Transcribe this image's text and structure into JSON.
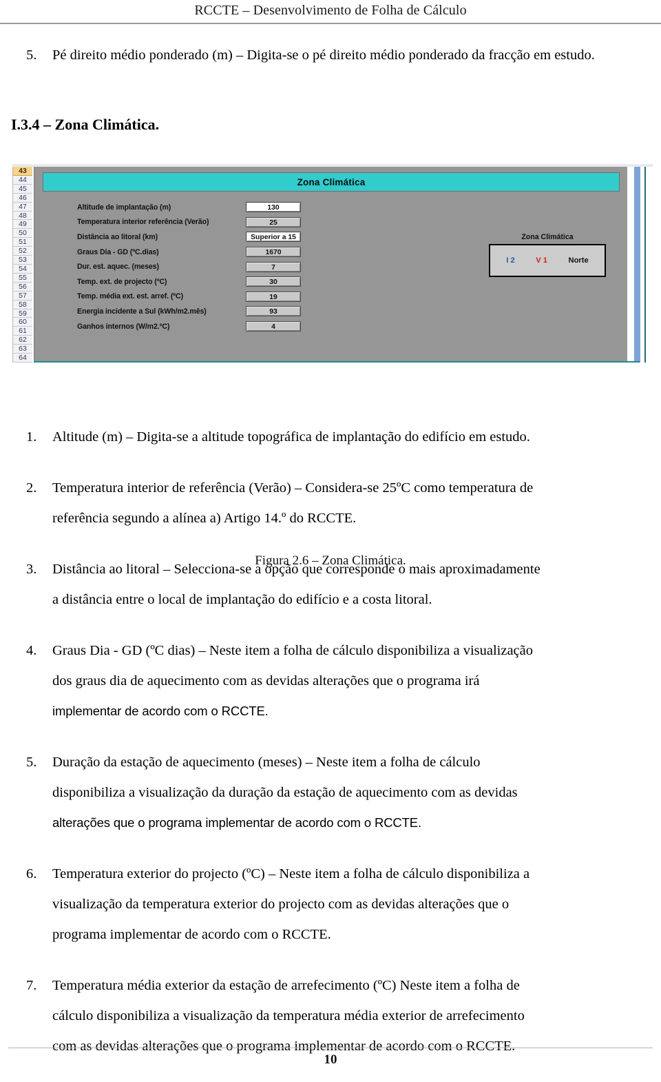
{
  "document": {
    "running_header": "RCCTE – Desenvolvimento de Folha de Cálculo",
    "page_number": "10"
  },
  "top_list": {
    "item5_marker": "5.",
    "item5_text": "Pé direito médio ponderado (m) – Digita-se o pé direito médio ponderado da fracção em estudo."
  },
  "section": {
    "heading": "I.3.4 – Zona Climática."
  },
  "figure": {
    "caption": "Figura 2.6 – Zona Climática.",
    "banner_title": "Zona Climática",
    "row_headers": [
      "43",
      "44",
      "45",
      "46",
      "47",
      "48",
      "49",
      "50",
      "51",
      "52",
      "53",
      "54",
      "55",
      "56",
      "57",
      "58",
      "59",
      "60",
      "61",
      "62",
      "63",
      "64"
    ],
    "selected_row": "43",
    "fields": [
      {
        "label": "Altitude de implantação (m)",
        "value": "130",
        "kind": "input"
      },
      {
        "label": "Temperatura interior referência (Verão)",
        "value": "25",
        "kind": "computed"
      },
      {
        "label": "Distância ao litoral (km)",
        "value": "Superior a 15",
        "kind": "input"
      },
      {
        "label": "Graus Dia - GD (ºC.dias)",
        "value": "1670",
        "kind": "computed"
      },
      {
        "label": "Dur. est. aquec. (meses)",
        "value": "7",
        "kind": "computed"
      },
      {
        "label": "Temp. ext. de projecto (ºC)",
        "value": "30",
        "kind": "computed"
      },
      {
        "label": "Temp. média ext. est. arref. (ºC)",
        "value": "19",
        "kind": "computed"
      },
      {
        "label": "Energia incidente a Sul (kWh/m2.mês)",
        "value": "93",
        "kind": "computed"
      },
      {
        "label": "Ganhos internos (W/m2.ºC)",
        "value": "4",
        "kind": "computed"
      }
    ],
    "result": {
      "caption": "Zona Climática",
      "winter": "I 2",
      "summer": "V 1",
      "region": "Norte"
    },
    "colors": {
      "banner": "#33CCCC",
      "sheet_background": "#969696",
      "result_box": "#CCCCCC",
      "winter_text": "#3355AA",
      "summer_text": "#CC2222",
      "selected_row_header": "#FBD38A",
      "scrollbar": "#7FA3D6"
    }
  },
  "body_list": [
    {
      "marker": "1.",
      "lines": [
        {
          "text": "Altitude (m) – Digita-se a altitude topográfica de implantação do edifício em estudo.",
          "face": "serif"
        }
      ]
    },
    {
      "marker": "2.",
      "lines": [
        {
          "text": "Temperatura interior de referência (Verão) – Considera-se 25ºC como temperatura de",
          "face": "serif"
        },
        {
          "text": "referência segundo a alínea a) Artigo 14.º do RCCTE.",
          "face": "serif"
        }
      ]
    },
    {
      "marker": "3.",
      "lines": [
        {
          "text": "Distância ao litoral – Selecciona-se a opção que corresponde o mais aproximadamente",
          "face": "serif"
        },
        {
          "text": "a distância entre o local de implantação do edifício e a costa litoral.",
          "face": "serif"
        }
      ]
    },
    {
      "marker": "4.",
      "lines": [
        {
          "text": "Graus Dia - GD (ºC dias) – Neste item a folha de cálculo disponibiliza a visualização",
          "face": "serif"
        },
        {
          "text": "dos graus dia de aquecimento com as devidas alterações que o programa irá",
          "face": "serif"
        },
        {
          "text": "implementar de acordo com o RCCTE.",
          "face": "sans"
        }
      ]
    },
    {
      "marker": "5.",
      "lines": [
        {
          "text": "Duração da estação de aquecimento (meses) – Neste item a folha de cálculo",
          "face": "serif"
        },
        {
          "text": "disponibiliza a visualização da duração da estação de aquecimento com as devidas",
          "face": "serif"
        },
        {
          "text": "alterações que o programa implementar de acordo com o RCCTE.",
          "face": "sans"
        }
      ]
    },
    {
      "marker": "6.",
      "lines": [
        {
          "text": "Temperatura exterior do projecto (ºC) – Neste item a folha de cálculo disponibiliza a",
          "face": "serif"
        },
        {
          "text": "visualização da temperatura exterior do projecto com as devidas alterações que o",
          "face": "serif"
        },
        {
          "text": "programa implementar de acordo com o RCCTE.",
          "face": "serif"
        }
      ]
    },
    {
      "marker": "7.",
      "lines": [
        {
          "text": "Temperatura média exterior da estação de arrefecimento (ºC) Neste item a folha de",
          "face": "serif"
        },
        {
          "text": "cálculo disponibiliza a visualização da temperatura média exterior de arrefecimento",
          "face": "serif"
        },
        {
          "text": "com as devidas alterações que o programa implementar de acordo com o RCCTE.",
          "face": "serif"
        }
      ]
    }
  ]
}
